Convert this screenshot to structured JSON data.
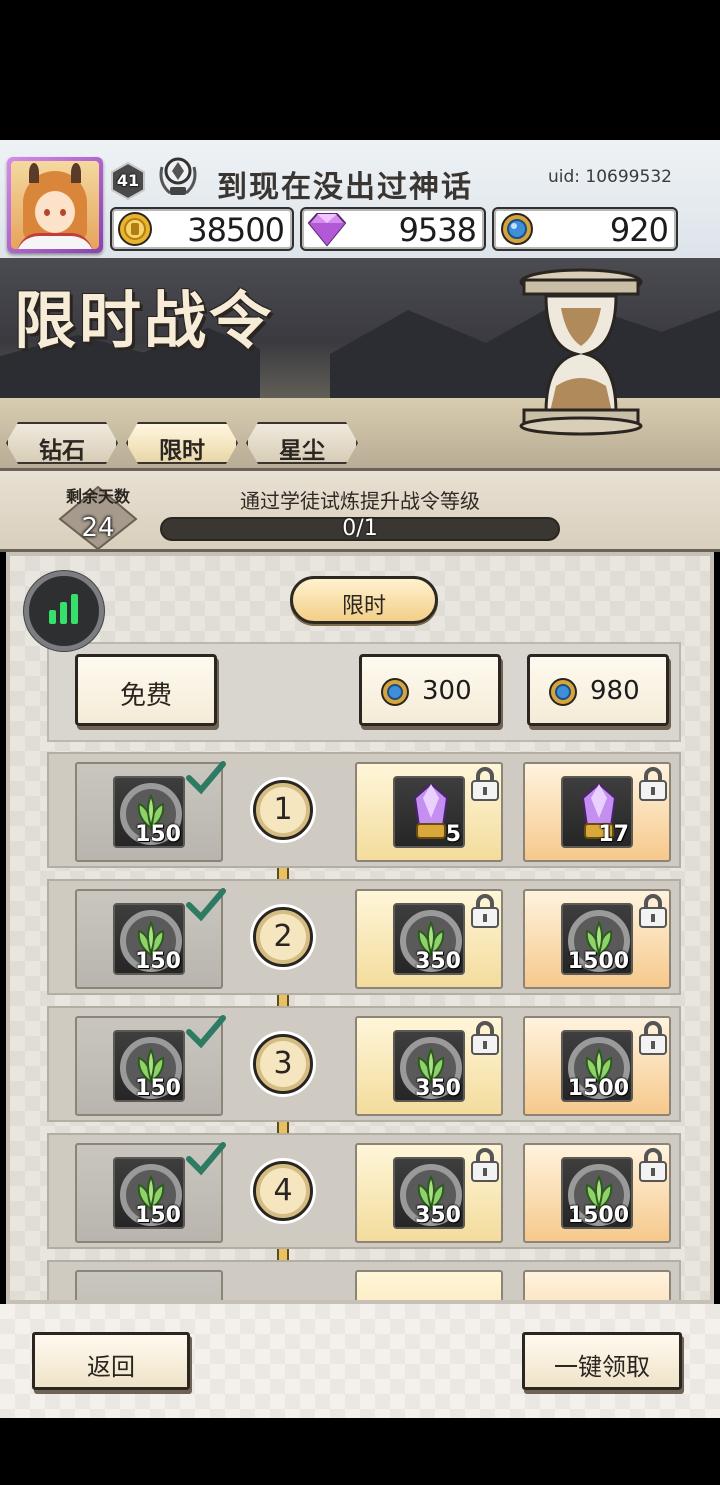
{
  "player": {
    "name": "到现在没出过神话",
    "level": "41",
    "uid": "uid: 10699532"
  },
  "currencies": {
    "gold": "38500",
    "diamond": "9538",
    "stardust": "920"
  },
  "banner": {
    "title": "限时战令"
  },
  "tabs": [
    {
      "label": "钻石"
    },
    {
      "label": "限时"
    },
    {
      "label": "星尘"
    }
  ],
  "progress": {
    "days_label": "剩余天数",
    "days_value": "24",
    "task": "通过学徒试炼提升战令等级",
    "value_text": "0/1",
    "fraction": 0
  },
  "season_label": "限时",
  "tiers": {
    "free_label": "免费",
    "tier1_price": "300",
    "tier2_price": "980"
  },
  "rewards": [
    {
      "level": "1",
      "free_amount": "150",
      "tier1_amount": "5",
      "tier2_amount": "17",
      "paid_item": "crystal-icon"
    },
    {
      "level": "2",
      "free_amount": "150",
      "tier1_amount": "350",
      "tier2_amount": "1500",
      "paid_item": "leaf-icon"
    },
    {
      "level": "3",
      "free_amount": "150",
      "tier1_amount": "350",
      "tier2_amount": "1500",
      "paid_item": "leaf-icon"
    },
    {
      "level": "4",
      "free_amount": "150",
      "tier1_amount": "350",
      "tier2_amount": "1500",
      "paid_item": "leaf-icon"
    }
  ],
  "footer": {
    "back_label": "返回",
    "claim_all_label": "一键领取"
  },
  "colors": {
    "accent_gold": "#e4b53c",
    "signal_green": "#35e06b",
    "check_green": "#2f7a62"
  }
}
